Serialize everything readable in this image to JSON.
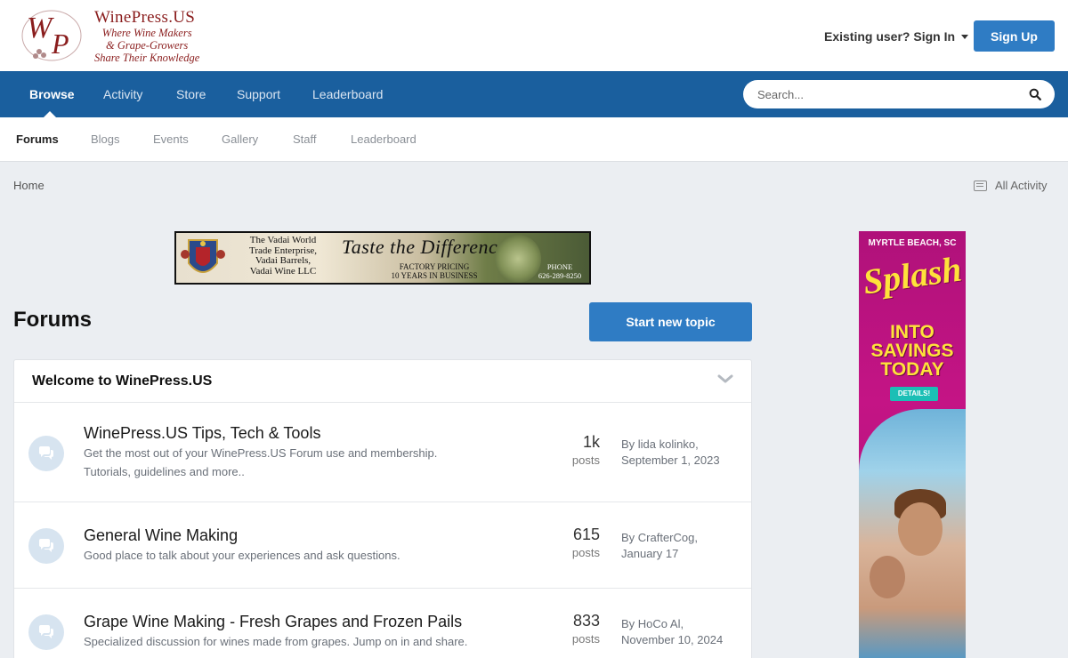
{
  "brand": {
    "title": "WinePress.US",
    "tagline": [
      "Where Wine Makers",
      "& Grape-Growers",
      "Share Their Knowledge"
    ],
    "monogram": "WP"
  },
  "header": {
    "signin_label": "Existing user? Sign In",
    "signup_label": "Sign Up"
  },
  "nav": {
    "items": [
      "Browse",
      "Activity",
      "Store",
      "Support",
      "Leaderboard"
    ],
    "active": "Browse"
  },
  "search": {
    "placeholder": "Search..."
  },
  "subnav": {
    "items": [
      "Forums",
      "Blogs",
      "Events",
      "Gallery",
      "Staff",
      "Leaderboard"
    ],
    "active": "Forums"
  },
  "breadcrumb": {
    "home": "Home",
    "all_activity": "All Activity"
  },
  "banner": {
    "left_text": [
      "The Vadai World",
      "Trade Enterprise,",
      "Vadai Barrels,",
      "Vadai Wine LLC"
    ],
    "slogan": "Taste the Difference",
    "pricing": [
      "FACTORY PRICING",
      "10 YEARS IN BUSINESS"
    ],
    "phone_label": "PHONE",
    "phone": "626-289-8250"
  },
  "page": {
    "title": "Forums",
    "new_topic_label": "Start new topic"
  },
  "category": {
    "title": "Welcome to WinePress.US"
  },
  "forums": [
    {
      "title": "WinePress.US Tips, Tech & Tools",
      "desc": "Get the most out of your WinePress.US Forum use and membership. Tutorials, guidelines and more..",
      "count": "1k",
      "count_label": "posts",
      "by": "By lida kolinko,",
      "date": "September 1, 2023"
    },
    {
      "title": "General Wine Making",
      "desc": "Good place to talk about your experiences and ask questions.",
      "count": "615",
      "count_label": "posts",
      "by": "By CrafterCog,",
      "date": "January 17"
    },
    {
      "title": "Grape Wine Making - Fresh Grapes and Frozen Pails",
      "desc": "Specialized discussion for wines made from grapes. Jump on in and share.",
      "count": "833",
      "count_label": "posts",
      "by": "By HoCo Al,",
      "date": "November 10, 2024"
    }
  ],
  "ad": {
    "location": "MYRTLE BEACH, SC",
    "splash": "Splash",
    "headline": [
      "INTO",
      "SAVINGS",
      "TODAY"
    ],
    "details": "DETAILS!"
  },
  "colors": {
    "nav_bg": "#1a5f9e",
    "button": "#2f7cc4",
    "brand": "#8a1d1d",
    "page_bg": "#ebeef2"
  }
}
